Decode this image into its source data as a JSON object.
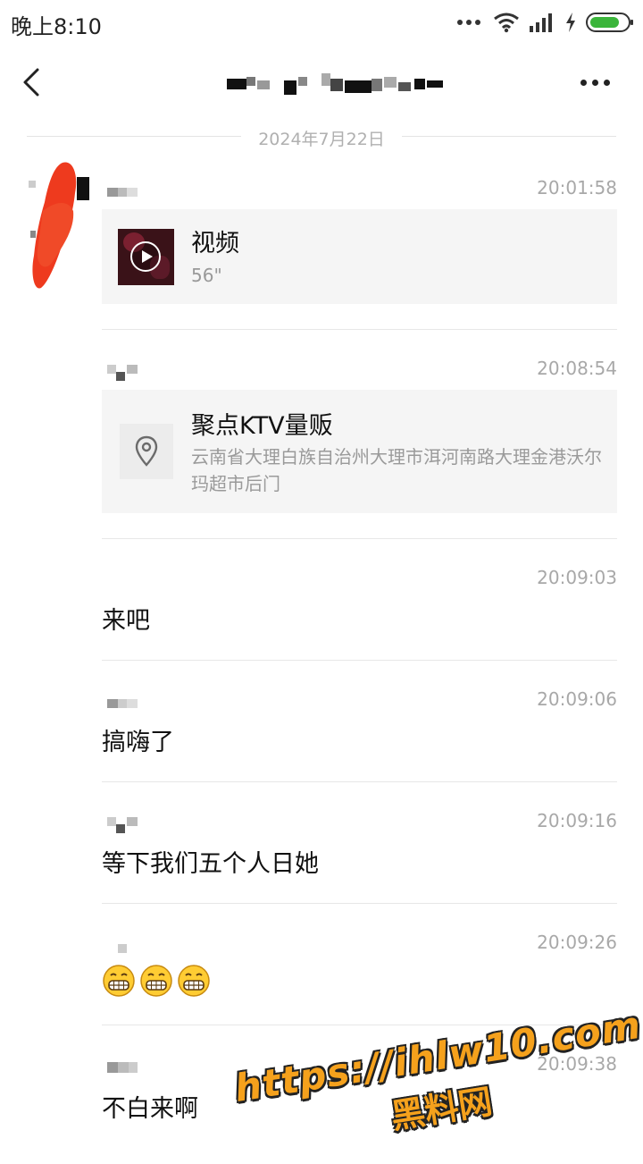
{
  "status_bar": {
    "time": "晚上8:10",
    "icons": [
      "more-dots-icon",
      "wifi-icon",
      "signal-icon",
      "charging-icon",
      "battery-icon"
    ],
    "battery_color": "#3bb53b"
  },
  "header": {
    "back_icon": "chevron-left-icon",
    "title_pixelated": true,
    "more_icon": "more-horizontal-icon"
  },
  "date_divider": "2024年7月22日",
  "messages": [
    {
      "time": "20:01:58",
      "type": "video",
      "title": "视频",
      "duration": "56\""
    },
    {
      "time": "20:08:54",
      "type": "location",
      "title": "聚点KTV量贩",
      "address": "云南省大理白族自治州大理市洱河南路大理金港沃尔玛超市后门"
    },
    {
      "time": "20:09:03",
      "type": "text",
      "text": "来吧"
    },
    {
      "time": "20:09:06",
      "type": "text",
      "text": "搞嗨了"
    },
    {
      "time": "20:09:16",
      "type": "text",
      "text": "等下我们五个人日她"
    },
    {
      "time": "20:09:26",
      "type": "emoji",
      "emoji": [
        "😁",
        "😁",
        "😁"
      ]
    },
    {
      "time": "20:09:38",
      "type": "text",
      "text": "不白来啊"
    }
  ],
  "watermark": {
    "url": "https://ihlw10.com",
    "name": "黑料网",
    "color": "#f5a11c"
  },
  "colors": {
    "redaction_red": "#ee3a1e",
    "text_secondary": "#a8a8a8",
    "card_bg": "#f5f5f5"
  }
}
